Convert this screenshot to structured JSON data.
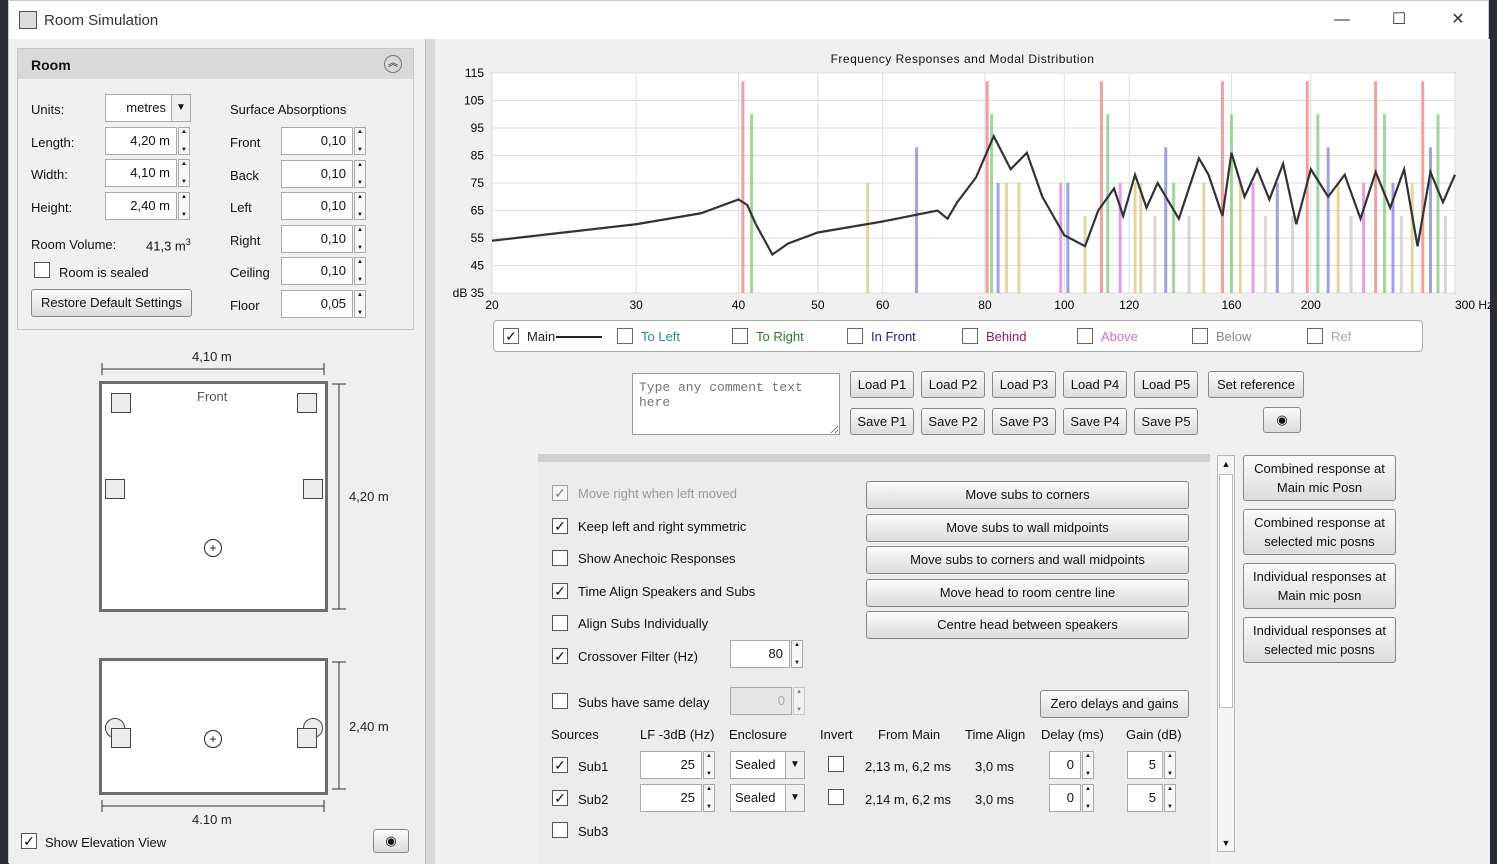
{
  "window": {
    "title": "Room Simulation",
    "minimize": "—",
    "maximize": "☐",
    "close": "✕"
  },
  "room": {
    "header": "Room",
    "units_label": "Units:",
    "units_value": "metres",
    "length_label": "Length:",
    "length_value": "4,20 m",
    "width_label": "Width:",
    "width_value": "4,10 m",
    "height_label": "Height:",
    "height_value": "2,40 m",
    "volume_label": "Room Volume:",
    "volume_value": "41,3 m",
    "volume_exp": "3",
    "sealed_label": "Room is sealed",
    "restore_button": "Restore Default Settings",
    "surface_label": "Surface Absorptions",
    "surfaces": [
      {
        "name": "Front",
        "value": "0,10"
      },
      {
        "name": "Back",
        "value": "0,10"
      },
      {
        "name": "Left",
        "value": "0,10"
      },
      {
        "name": "Right",
        "value": "0,10"
      },
      {
        "name": "Ceiling",
        "value": "0,10"
      },
      {
        "name": "Floor",
        "value": "0,05"
      }
    ]
  },
  "plan": {
    "top_width": "4,10 m",
    "front": "Front",
    "side_length": "4,20 m",
    "elev_height": "2,40 m",
    "elev_width": "4.10 m",
    "show_elevation": "Show Elevation View"
  },
  "chart_data": {
    "type": "line",
    "title": "Frequency Responses and Modal Distribution",
    "xscale": "log",
    "xlim": [
      20,
      300
    ],
    "ylim": [
      35,
      115
    ],
    "xticks": [
      "20",
      "30",
      "40",
      "50",
      "60",
      "80",
      "100",
      "120",
      "160",
      "200",
      "300 Hz"
    ],
    "yticks": [
      "115",
      "105",
      "95",
      "85",
      "75",
      "65",
      "55",
      "45",
      "dB 35"
    ],
    "series": [
      {
        "name": "Main",
        "x": [
          20,
          30,
          36,
          40,
          41,
          42,
          44,
          46,
          50,
          60,
          70,
          72,
          74,
          78,
          82,
          86,
          90,
          94,
          100,
          106,
          110,
          115,
          118,
          122,
          126,
          130,
          138,
          146,
          150,
          156,
          160,
          166,
          172,
          178,
          185,
          192,
          200,
          210,
          220,
          230,
          240,
          250,
          260,
          270,
          280,
          290,
          300
        ],
        "y": [
          54,
          60,
          64,
          69,
          67,
          60,
          49,
          53,
          57,
          61,
          65,
          62,
          68,
          77,
          92,
          80,
          86,
          70,
          56,
          52,
          65,
          73,
          63,
          78,
          66,
          75,
          62,
          84,
          78,
          63,
          86,
          70,
          80,
          69,
          82,
          60,
          80,
          70,
          78,
          62,
          79,
          66,
          80,
          52,
          79,
          68,
          78
        ]
      }
    ],
    "modes": [
      {
        "f": 40.5,
        "h": 112,
        "c": "#e88"
      },
      {
        "f": 41.5,
        "h": 100,
        "c": "#8c8"
      },
      {
        "f": 57.5,
        "h": 75,
        "c": "#dc8"
      },
      {
        "f": 66,
        "h": 88,
        "c": "#88d"
      },
      {
        "f": 80.5,
        "h": 112,
        "c": "#e88"
      },
      {
        "f": 81.5,
        "h": 100,
        "c": "#8c8"
      },
      {
        "f": 83,
        "h": 75,
        "c": "#88d"
      },
      {
        "f": 85,
        "h": 75,
        "c": "#dc8"
      },
      {
        "f": 88,
        "h": 75,
        "c": "#dc8"
      },
      {
        "f": 99,
        "h": 75,
        "c": "#d8d"
      },
      {
        "f": 101,
        "h": 75,
        "c": "#88d"
      },
      {
        "f": 106,
        "h": 63,
        "c": "#dc8"
      },
      {
        "f": 111,
        "h": 112,
        "c": "#e88"
      },
      {
        "f": 113,
        "h": 100,
        "c": "#8c8"
      },
      {
        "f": 117,
        "h": 75,
        "c": "#d8d"
      },
      {
        "f": 122,
        "h": 75,
        "c": "#dc8"
      },
      {
        "f": 124,
        "h": 75,
        "c": "#dc8"
      },
      {
        "f": 129,
        "h": 63,
        "c": "#ccc"
      },
      {
        "f": 133,
        "h": 88,
        "c": "#88d"
      },
      {
        "f": 136,
        "h": 75,
        "c": "#8c8"
      },
      {
        "f": 142,
        "h": 63,
        "c": "#ccc"
      },
      {
        "f": 148,
        "h": 75,
        "c": "#dc8"
      },
      {
        "f": 156,
        "h": 112,
        "c": "#e88"
      },
      {
        "f": 160,
        "h": 100,
        "c": "#8c8"
      },
      {
        "f": 164,
        "h": 75,
        "c": "#dc8"
      },
      {
        "f": 170,
        "h": 75,
        "c": "#d8d"
      },
      {
        "f": 176,
        "h": 63,
        "c": "#ccc"
      },
      {
        "f": 182,
        "h": 75,
        "c": "#88d"
      },
      {
        "f": 190,
        "h": 63,
        "c": "#ccc"
      },
      {
        "f": 198,
        "h": 112,
        "c": "#e88"
      },
      {
        "f": 204,
        "h": 100,
        "c": "#8c8"
      },
      {
        "f": 210,
        "h": 88,
        "c": "#88d"
      },
      {
        "f": 216,
        "h": 75,
        "c": "#dc8"
      },
      {
        "f": 224,
        "h": 63,
        "c": "#ccc"
      },
      {
        "f": 232,
        "h": 75,
        "c": "#d8d"
      },
      {
        "f": 240,
        "h": 112,
        "c": "#e88"
      },
      {
        "f": 246,
        "h": 100,
        "c": "#8c8"
      },
      {
        "f": 252,
        "h": 75,
        "c": "#88d"
      },
      {
        "f": 258,
        "h": 63,
        "c": "#ccc"
      },
      {
        "f": 266,
        "h": 75,
        "c": "#dc8"
      },
      {
        "f": 274,
        "h": 112,
        "c": "#e88"
      },
      {
        "f": 280,
        "h": 88,
        "c": "#88d"
      },
      {
        "f": 286,
        "h": 100,
        "c": "#8c8"
      },
      {
        "f": 292,
        "h": 63,
        "c": "#ccc"
      }
    ]
  },
  "legend": [
    {
      "label": "Main",
      "color": "#222",
      "checked": true
    },
    {
      "label": "To Left",
      "color": "#2a8a8a",
      "checked": false
    },
    {
      "label": "To Right",
      "color": "#2a7a2a",
      "checked": false
    },
    {
      "label": "In Front",
      "color": "#1a1a9a",
      "checked": false
    },
    {
      "label": "Behind",
      "color": "#8a1a6a",
      "checked": false
    },
    {
      "label": "Above",
      "color": "#d070d0",
      "checked": false
    },
    {
      "label": "Below",
      "color": "#888",
      "checked": false
    },
    {
      "label": "Ref",
      "color": "#aaa",
      "checked": false
    }
  ],
  "comment_placeholder": "Type any comment text here",
  "load_buttons": [
    "Load P1",
    "Load P2",
    "Load P3",
    "Load P4",
    "Load P5"
  ],
  "save_buttons": [
    "Save P1",
    "Save P2",
    "Save P3",
    "Save P4",
    "Save P5"
  ],
  "set_reference": "Set reference",
  "options": [
    {
      "label": "Move right when left moved",
      "checked": true,
      "disabled": true
    },
    {
      "label": "Keep left and right symmetric",
      "checked": true
    },
    {
      "label": "Show Anechoic Responses",
      "checked": false
    },
    {
      "label": "Time Align Speakers and Subs",
      "checked": true
    },
    {
      "label": "Align Subs Individually",
      "checked": false
    },
    {
      "label": "Crossover Filter (Hz)",
      "checked": true
    }
  ],
  "crossover_value": "80",
  "subs_same_delay": "Subs have same delay",
  "subs_delay_value": "0",
  "move_buttons": [
    "Move subs to corners",
    "Move subs to wall midpoints",
    "Move subs to corners and wall midpoints",
    "Move head to room centre line",
    "Centre head between speakers"
  ],
  "zero_button": "Zero delays and gains",
  "table": {
    "headers": [
      "Sources",
      "LF -3dB (Hz)",
      "Enclosure",
      "Invert",
      "From Main",
      "Time Align",
      "Delay (ms)",
      "Gain (dB)"
    ],
    "rows": [
      {
        "name": "Sub1",
        "checked": true,
        "lf": "25",
        "enclosure": "Sealed",
        "from_main": "2,13 m, 6,2 ms",
        "time_align": "3,0 ms",
        "delay": "0",
        "gain": "5"
      },
      {
        "name": "Sub2",
        "checked": true,
        "lf": "25",
        "enclosure": "Sealed",
        "from_main": "2,14 m, 6,2 ms",
        "time_align": "3,0 ms",
        "delay": "0",
        "gain": "5"
      },
      {
        "name": "Sub3",
        "checked": false
      }
    ]
  },
  "combined_buttons": [
    "Combined response at Main mic Posn",
    "Combined response at selected mic posns",
    "Individual responses at Main mic posn",
    "Individual responses at selected mic posns"
  ]
}
